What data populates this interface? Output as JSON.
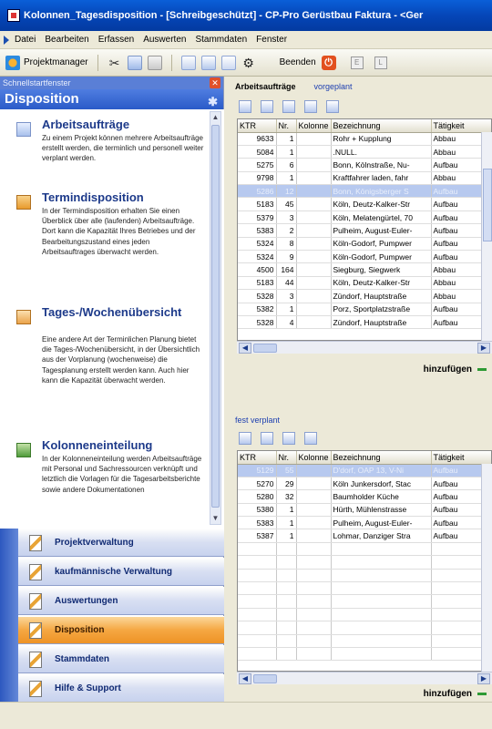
{
  "window": {
    "title": "Kolonnen_Tagesdisposition - [Schreibgeschützt] - CP-Pro Gerüstbau Faktura - <Ger"
  },
  "menu": [
    "Datei",
    "Bearbeiten",
    "Erfassen",
    "Auswerten",
    "Stammdaten",
    "Fenster"
  ],
  "toolbar": {
    "projektmanager": "Projektmanager",
    "beenden": "Beenden",
    "box1": "E",
    "box2": "L"
  },
  "quickstart": {
    "header": "Schnellstartfenster",
    "panel_title": "Disposition",
    "tasks": [
      {
        "title": "Arbeitsaufträge",
        "desc": "Zu einem Projekt können mehrere Arbeitsaufträge erstellt werden, die terminlich und personell weiter verplant werden."
      },
      {
        "title": "Termindisposition",
        "desc": "In der Termindisposition erhalten Sie einen Überblick über alle (laufenden) Arbeitsaufträge. Dort kann die Kapazität Ihres Betriebes und der Bearbeitungszustand eines jeden Arbeitsauftrages überwacht werden."
      },
      {
        "title": "Tages-/Wochenübersicht",
        "desc": "Eine andere Art der Terminlichen Planung bietet die Tages-/Wochenübersicht, in der Übersichtlich aus der Vorplanung (wochenweise) die Tagesplanung erstellt werden kann. Auch hier kann die Kapazität überwacht werden."
      },
      {
        "title": "Kolonneneinteilung",
        "desc": "In der Kolonneneinteilung werden Arbeitsaufträge mit Personal und Sachressourcen verknüpft und letztlich die Vorlagen für die Tagesarbeitsberichte sowie andere Dokumentationen"
      }
    ],
    "nav": [
      "Projektverwaltung",
      "kaufmännische Verwaltung",
      "Auswertungen",
      "Disposition",
      "Stammdaten",
      "Hilfe & Support"
    ]
  },
  "top_section": {
    "tab1": "Arbeitsaufträge",
    "tab2": "vorgeplant",
    "columns": [
      "KTR",
      "Nr.",
      "Kolonne",
      "Bezeichnung",
      "Tätigkeit"
    ],
    "rows": [
      [
        "9633",
        "1",
        "",
        "Rohr + Kupplung",
        "Abbau"
      ],
      [
        "5084",
        "1",
        "",
        ".NULL.",
        "Abbau"
      ],
      [
        "5275",
        "6",
        "",
        "Bonn, Kölnstraße, Nu-",
        "Aufbau"
      ],
      [
        "9798",
        "1",
        "",
        "Kraftfahrer laden, fahr",
        "Abbau"
      ],
      [
        "5286",
        "12",
        "",
        "Bonn, Königsberger S",
        "Aufbau"
      ],
      [
        "5183",
        "45",
        "",
        "Köln, Deutz-Kalker-Str",
        "Aufbau"
      ],
      [
        "5379",
        "3",
        "",
        "Köln, Melatengürtel, 70",
        "Aufbau"
      ],
      [
        "5383",
        "2",
        "",
        "Pulheim, August-Euler-",
        "Aufbau"
      ],
      [
        "5324",
        "8",
        "",
        "Köln-Godorf, Pumpwer",
        "Aufbau"
      ],
      [
        "5324",
        "9",
        "",
        "Köln-Godorf, Pumpwer",
        "Aufbau"
      ],
      [
        "4500",
        "164",
        "",
        "Siegburg, Siegwerk",
        "Abbau"
      ],
      [
        "5183",
        "44",
        "",
        "Köln, Deutz-Kalker-Str",
        "Abbau"
      ],
      [
        "5328",
        "3",
        "",
        "Zündorf, Hauptstraße",
        "Abbau"
      ],
      [
        "5382",
        "1",
        "",
        "Porz, Sportplatzstraße",
        "Aufbau"
      ],
      [
        "5328",
        "4",
        "",
        "Zündorf, Hauptstraße",
        "Aufbau"
      ]
    ],
    "add_label": "hinzufügen"
  },
  "bottom_section": {
    "label": "fest verplant",
    "columns": [
      "KTR",
      "Nr.",
      "Kolonne",
      "Bezeichnung",
      "Tätigkeit"
    ],
    "rows": [
      [
        "5129",
        "55",
        "",
        "D'dorf, OAP 13, V-Ni",
        "Aufbau"
      ],
      [
        "5270",
        "29",
        "",
        "Köln Junkersdorf, Stac",
        "Aufbau"
      ],
      [
        "5280",
        "32",
        "",
        "Baumholder Küche",
        "Aufbau"
      ],
      [
        "5380",
        "1",
        "",
        "Hürth, Mühlenstrasse",
        "Aufbau"
      ],
      [
        "5383",
        "1",
        "",
        "Pulheim, August-Euler-",
        "Aufbau"
      ],
      [
        "5387",
        "1",
        "",
        "Lohmar, Danziger Stra",
        "Aufbau"
      ]
    ],
    "add_label": "hinzufügen"
  },
  "colors": {
    "accent": "#2a5bc8",
    "active_nav": "#f5a742",
    "selected_row": "#b7c9ef"
  }
}
